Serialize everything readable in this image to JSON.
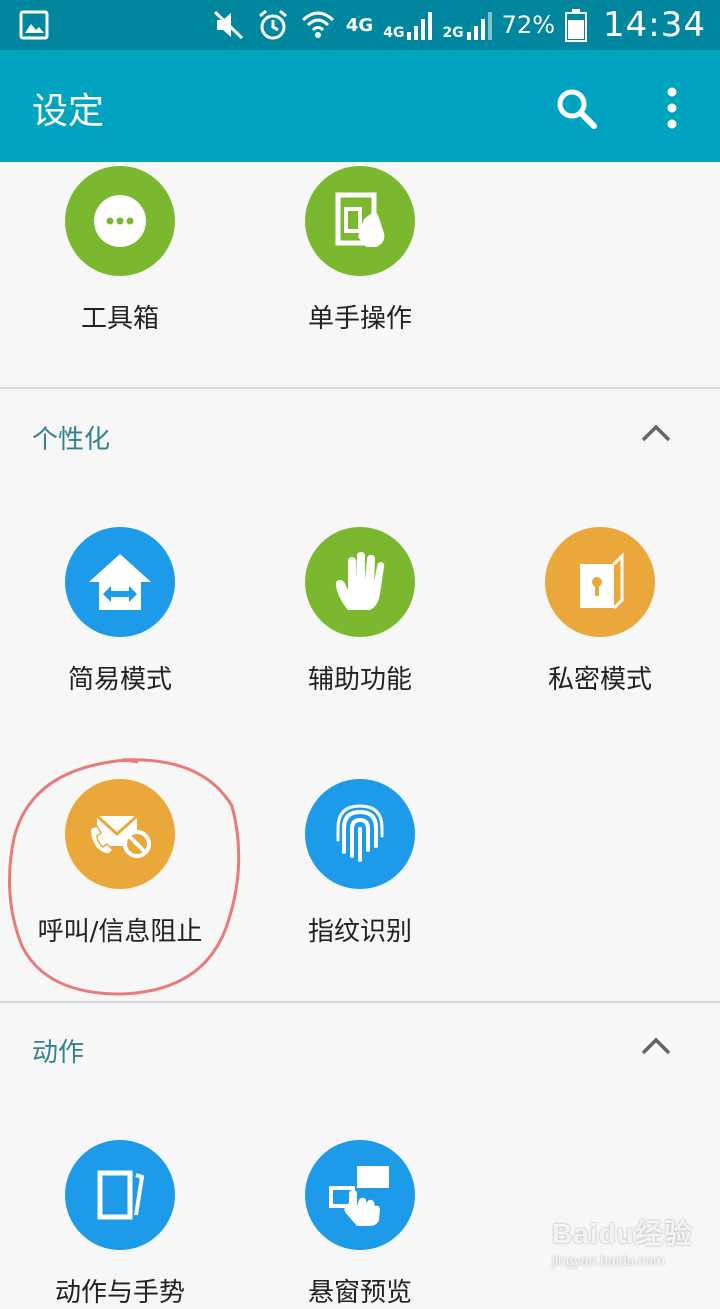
{
  "status_bar": {
    "network_primary": "4G",
    "network_sim1": "4G",
    "network_sim2": "2G",
    "battery_percent": "72%",
    "time": "14:34",
    "icons": [
      "gallery-icon",
      "mute-icon",
      "alarm-icon",
      "wifi-icon",
      "signal-icon",
      "battery-icon"
    ]
  },
  "app_bar": {
    "title": "设定",
    "icons": [
      "search-icon",
      "more-vert-icon"
    ]
  },
  "sections": [
    {
      "title": "",
      "tiles": [
        {
          "label": "工具箱",
          "icon": "toolbox-icon",
          "color": "#7bb82f"
        },
        {
          "label": "单手操作",
          "icon": "one-hand-icon",
          "color": "#7bb82f"
        }
      ]
    },
    {
      "title": "个性化",
      "collapse_icon": "chevron-up-icon",
      "tiles": [
        {
          "label": "简易模式",
          "icon": "easy-mode-icon",
          "color": "#1e9be8"
        },
        {
          "label": "辅助功能",
          "icon": "hand-icon",
          "color": "#7bb82f"
        },
        {
          "label": "私密模式",
          "icon": "private-mode-icon",
          "color": "#eba83a"
        },
        {
          "label": "呼叫/信息阻止",
          "icon": "call-block-icon",
          "color": "#eba83a"
        },
        {
          "label": "指纹识别",
          "icon": "fingerprint-icon",
          "color": "#1e9be8"
        }
      ]
    },
    {
      "title": "动作",
      "collapse_icon": "chevron-up-icon",
      "tiles": [
        {
          "label": "动作与手势",
          "icon": "motion-icon",
          "color": "#1e9be8"
        },
        {
          "label": "悬窗预览",
          "icon": "air-view-icon",
          "color": "#1e9be8"
        }
      ]
    }
  ],
  "watermark": {
    "main": "Baidu经验",
    "sub": "jingyan.baidu.com"
  },
  "colors": {
    "status_bar": "#00869e",
    "app_bar": "#00a4c1",
    "section_title": "#35828f",
    "annotation": "#e87a7a"
  }
}
